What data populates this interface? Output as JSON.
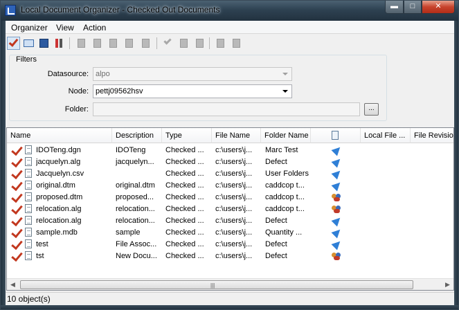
{
  "window": {
    "title": "Local Document Organizer - Checked Out Documents",
    "minimize_glyph": "▬",
    "maximize_glyph": "□",
    "close_glyph": "✕"
  },
  "menu": {
    "items": [
      "Organizer",
      "View",
      "Action"
    ]
  },
  "toolbar": {
    "icons": [
      "check-icon",
      "open-book-icon",
      "save-icon",
      "tools-icon",
      "doc-gray-icon",
      "doc-gray-icon",
      "doc-gray-icon",
      "doc-gray-icon",
      "doc-gray-icon",
      "check-gray-icon",
      "doc-gray-icon",
      "doc-gray-icon",
      "doc-gray-icon",
      "doc-gray-icon"
    ]
  },
  "filters": {
    "title": "Filters",
    "datasource_label": "Datasource:",
    "datasource_value": "alpo",
    "node_label": "Node:",
    "node_value": "pettj09562hsv",
    "folder_label": "Folder:",
    "folder_value": "",
    "browse_label": "..."
  },
  "grid": {
    "columns": [
      "Name",
      "Description",
      "Type",
      "File Name",
      "Folder Name",
      "",
      "Local File ...",
      "File Revision"
    ],
    "rows": [
      {
        "name": "IDOTeng.dgn",
        "description": "IDOTeng",
        "type": "Checked ...",
        "file_name": "c:\\users\\j...",
        "folder": "Marc Test",
        "status_icon": "arrow"
      },
      {
        "name": "jacquelyn.alg",
        "description": "jacquelyn...",
        "type": "Checked ...",
        "file_name": "c:\\users\\j...",
        "folder": "Defect",
        "status_icon": "arrow"
      },
      {
        "name": "Jacquelyn.csv",
        "description": "",
        "type": "Checked ...",
        "file_name": "c:\\users\\j...",
        "folder": "User Folders",
        "status_icon": "arrow"
      },
      {
        "name": "original.dtm",
        "description": "original.dtm",
        "type": "Checked ...",
        "file_name": "c:\\users\\j...",
        "folder": "caddcop t...",
        "status_icon": "arrow"
      },
      {
        "name": "proposed.dtm",
        "description": "proposed...",
        "type": "Checked ...",
        "file_name": "c:\\users\\j...",
        "folder": "caddcop t...",
        "status_icon": "people"
      },
      {
        "name": "relocation.alg",
        "description": "relocation...",
        "type": "Checked ...",
        "file_name": "c:\\users\\j...",
        "folder": "caddcop t...",
        "status_icon": "people"
      },
      {
        "name": "relocation.alg",
        "description": "relocation...",
        "type": "Checked ...",
        "file_name": "c:\\users\\j...",
        "folder": "Defect",
        "status_icon": "arrow"
      },
      {
        "name": "sample.mdb",
        "description": "sample",
        "type": "Checked ...",
        "file_name": "c:\\users\\j...",
        "folder": "Quantity ...",
        "status_icon": "arrow"
      },
      {
        "name": "test",
        "description": "File Assoc...",
        "type": "Checked ...",
        "file_name": "c:\\users\\j...",
        "folder": "Defect",
        "status_icon": "arrow"
      },
      {
        "name": "tst",
        "description": "New Docu...",
        "type": "Checked ...",
        "file_name": "c:\\users\\j...",
        "folder": "Defect",
        "status_icon": "people"
      }
    ],
    "scroll_left_glyph": "◀",
    "scroll_right_glyph": "▶",
    "scroll_grip": "|||"
  },
  "status": {
    "text": "10 object(s)"
  },
  "colors": {
    "check_red": "#c2381f",
    "arrow_blue": "#2f7fd6"
  }
}
